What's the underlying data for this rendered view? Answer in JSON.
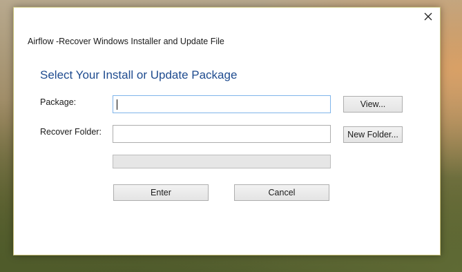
{
  "dialog": {
    "title": "Airflow -Recover Windows Installer and Update File",
    "heading": "Select Your Install or Update Package",
    "package_label": "Package:",
    "package_value": "",
    "recover_folder_label": "Recover Folder:",
    "recover_folder_value": "",
    "view_button": "View...",
    "new_folder_button": "New Folder...",
    "progress": 0,
    "enter_button": "Enter",
    "cancel_button": "Cancel",
    "close_icon": "close-icon"
  }
}
